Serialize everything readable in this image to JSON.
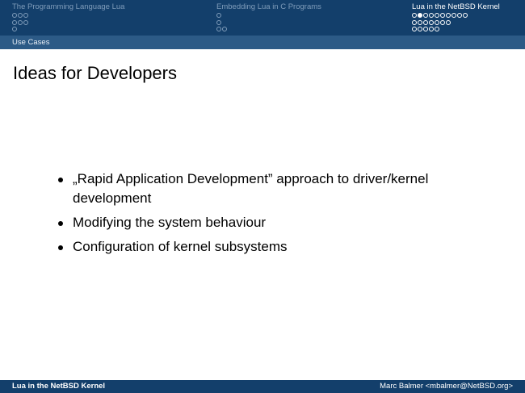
{
  "header": {
    "sections": [
      {
        "title": "The Programming Language Lua",
        "dots": [
          3,
          3,
          1
        ],
        "active": false
      },
      {
        "title": "Embedding Lua in C Programs",
        "dots": [
          1,
          1,
          2
        ],
        "active": false
      },
      {
        "title": "Lua in the NetBSD Kernel",
        "dots": [
          10,
          7,
          5
        ],
        "active": true,
        "current_dot": 1
      }
    ],
    "subsection": "Use Cases"
  },
  "frame": {
    "title": "Ideas for Developers",
    "bullets": [
      "„Rapid Application Development” approach to driver/kernel development",
      "Modifying the system behaviour",
      "Configuration of kernel subsystems"
    ]
  },
  "footer": {
    "left": "Lua in the NetBSD Kernel",
    "right": "Marc Balmer <mbalmer@NetBSD.org>"
  },
  "colors": {
    "header_bg": "#133f6b",
    "subbar_bg": "#2c5a86",
    "inactive_text": "#7f9cba"
  }
}
